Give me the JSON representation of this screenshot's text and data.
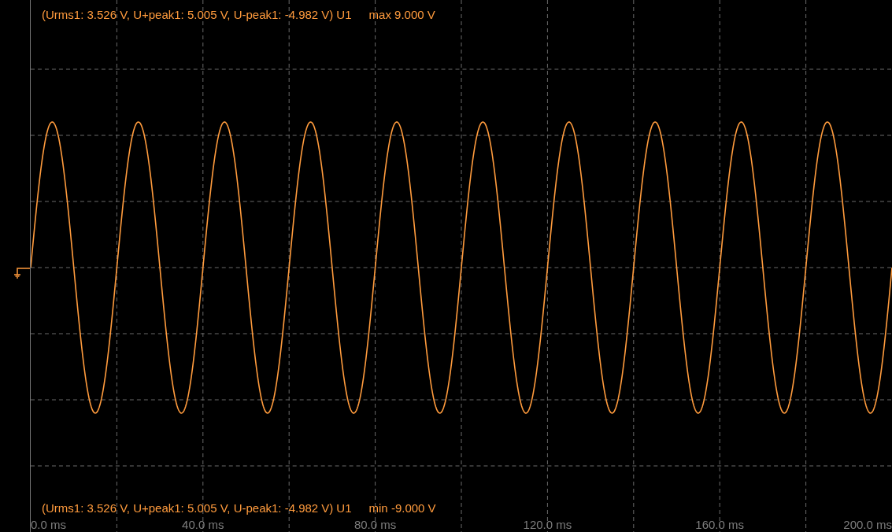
{
  "top_readout": {
    "measurements": "(Urms1: 3.526 V, U+peak1: 5.005 V, U-peak1: -4.982 V)",
    "channel": "U1",
    "limit": "max 9.000 V"
  },
  "bottom_readout": {
    "measurements": "(Urms1: 3.526 V, U+peak1: 5.005 V, U-peak1: -4.982 V)",
    "channel": "U1",
    "limit": "min -9.000 V"
  },
  "x_axis_labels": [
    "0.0 ms",
    "40.0 ms",
    "80.0 ms",
    "120.0 ms",
    "160.0 ms",
    "200.0 ms"
  ]
}
